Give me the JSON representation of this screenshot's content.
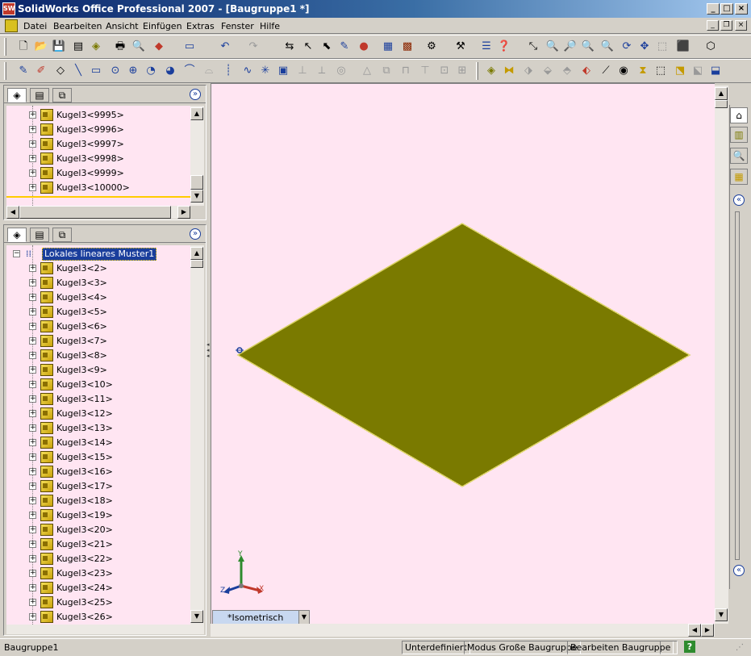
{
  "window": {
    "title": "SolidWorks Office Professional 2007 - [Baugruppe1 *]",
    "app_icon": "SW"
  },
  "menu": [
    {
      "label": "Datei",
      "name": "menu-datei"
    },
    {
      "label": "Bearbeiten",
      "name": "menu-bearbeiten"
    },
    {
      "label": "Ansicht",
      "name": "menu-ansicht"
    },
    {
      "label": "Einfügen",
      "name": "menu-einfuegen"
    },
    {
      "label": "Extras",
      "name": "menu-extras"
    },
    {
      "label": "Fenster",
      "name": "menu-fenster"
    },
    {
      "label": "Hilfe",
      "name": "menu-hilfe"
    }
  ],
  "top_tree": {
    "items": [
      "Kugel3<9995>",
      "Kugel3<9996>",
      "Kugel3<9997>",
      "Kugel3<9998>",
      "Kugel3<9999>",
      "Kugel3<10000>"
    ]
  },
  "bottom_tree": {
    "header": "Lokales lineares Muster1",
    "items": [
      "Kugel3<2>",
      "Kugel3<3>",
      "Kugel3<4>",
      "Kugel3<5>",
      "Kugel3<6>",
      "Kugel3<7>",
      "Kugel3<8>",
      "Kugel3<9>",
      "Kugel3<10>",
      "Kugel3<11>",
      "Kugel3<12>",
      "Kugel3<13>",
      "Kugel3<14>",
      "Kugel3<15>",
      "Kugel3<16>",
      "Kugel3<17>",
      "Kugel3<18>",
      "Kugel3<19>",
      "Kugel3<20>",
      "Kugel3<21>",
      "Kugel3<22>",
      "Kugel3<23>",
      "Kugel3<24>",
      "Kugel3<25>",
      "Kugel3<26>"
    ]
  },
  "viewport": {
    "view_name": "*Isometrisch",
    "background": "#ffe5f2",
    "model_color": "#7a7a00"
  },
  "triad": {
    "x": "X",
    "y": "Y",
    "z": "Z"
  },
  "status": {
    "document": "Baugruppe1",
    "definition": "Unterdefiniert",
    "mode": "Modus Große Baugruppe",
    "editing": "Bearbeiten Baugruppe",
    "help": "?"
  },
  "colors": {
    "title_start": "#0a246a",
    "title_end": "#a6caf0",
    "tree_bg": "#ffe5f2",
    "highlight": "#ffcc00"
  }
}
